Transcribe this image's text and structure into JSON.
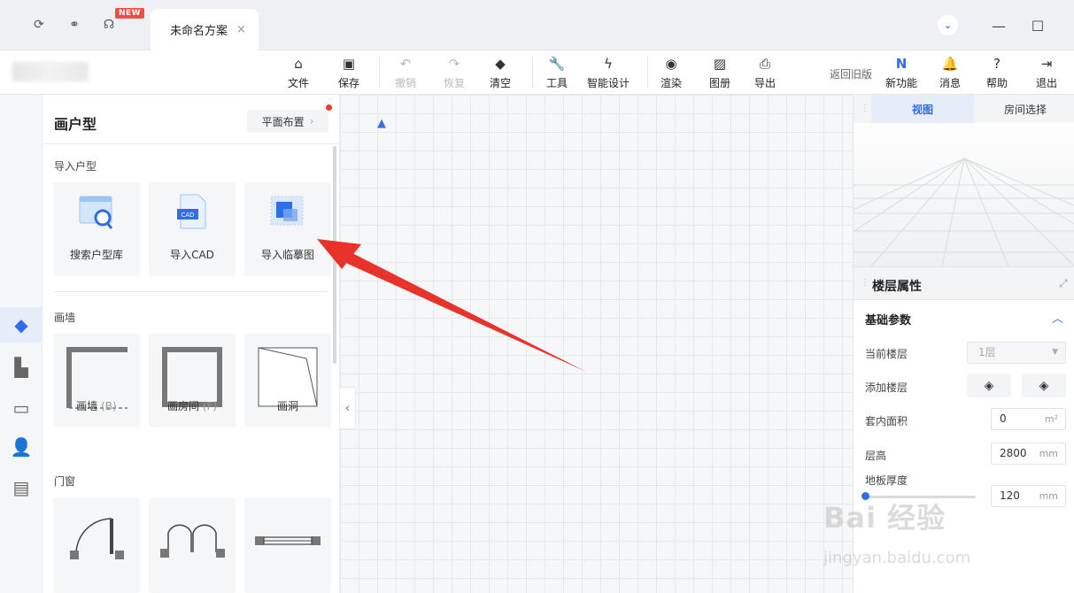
{
  "titlebar": {
    "new_badge": "NEW",
    "tab_title": "未命名方案",
    "tab_close": "×",
    "icons": [
      "refresh-icon",
      "link-icon",
      "headset-icon"
    ]
  },
  "toolbar": {
    "items": [
      {
        "label": "文件",
        "icon": "file-icon",
        "disabled": false
      },
      {
        "label": "保存",
        "icon": "save-icon",
        "disabled": false
      },
      {
        "label": "撤销",
        "icon": "undo-icon",
        "disabled": true
      },
      {
        "label": "恢复",
        "icon": "redo-icon",
        "disabled": true
      },
      {
        "label": "清空",
        "icon": "eraser-icon",
        "disabled": false
      },
      {
        "label": "工具",
        "icon": "wrench-icon",
        "disabled": false
      },
      {
        "label": "智能设计",
        "icon": "lightning-icon",
        "disabled": false
      },
      {
        "label": "渲染",
        "icon": "camera-icon",
        "disabled": false
      },
      {
        "label": "图册",
        "icon": "album-icon",
        "disabled": false
      },
      {
        "label": "导出",
        "icon": "export-icon",
        "disabled": false
      }
    ],
    "old_version": "返回旧版",
    "right_items": [
      {
        "label": "新功能",
        "icon": "new-feature-icon"
      },
      {
        "label": "消息",
        "icon": "bell-icon"
      },
      {
        "label": "帮助",
        "icon": "help-icon"
      },
      {
        "label": "退出",
        "icon": "logout-icon"
      }
    ]
  },
  "left_panel": {
    "title": "画户型",
    "layout_button": "平面布置",
    "sections": [
      {
        "title": "导入户型",
        "cards": [
          {
            "label": "搜索户型库",
            "shortcut": ""
          },
          {
            "label": "导入CAD",
            "shortcut": ""
          },
          {
            "label": "导入临摹图",
            "shortcut": ""
          }
        ]
      },
      {
        "title": "画墙",
        "cards": [
          {
            "label": "画墙",
            "shortcut": "(B)"
          },
          {
            "label": "画房间",
            "shortcut": "(F)"
          },
          {
            "label": "画洞",
            "shortcut": ""
          }
        ]
      },
      {
        "title": "门窗",
        "cards": [
          {
            "label": "",
            "shortcut": ""
          },
          {
            "label": "",
            "shortcut": ""
          },
          {
            "label": "",
            "shortcut": ""
          }
        ]
      }
    ],
    "cad_badge": "CAD"
  },
  "right_panel": {
    "tabs": [
      "视图",
      "房间选择"
    ],
    "props_title": "楼层属性",
    "basic_title": "基础参数",
    "rows": {
      "current_floor": {
        "label": "当前楼层",
        "value": "1层"
      },
      "add_floor": {
        "label": "添加楼层"
      },
      "area": {
        "label": "套内面积",
        "value": "0",
        "unit": "m²"
      },
      "height": {
        "label": "层高",
        "value": "2800",
        "unit": "mm"
      },
      "thickness": {
        "label": "地板厚度",
        "value": "120",
        "unit": "mm"
      }
    }
  },
  "watermark": {
    "brand": "Bai 经验",
    "url": "jingyan.baidu.com"
  },
  "colors": {
    "accent": "#2f6ee8",
    "annotation": "#e8332a",
    "badge": "#f04e45"
  }
}
